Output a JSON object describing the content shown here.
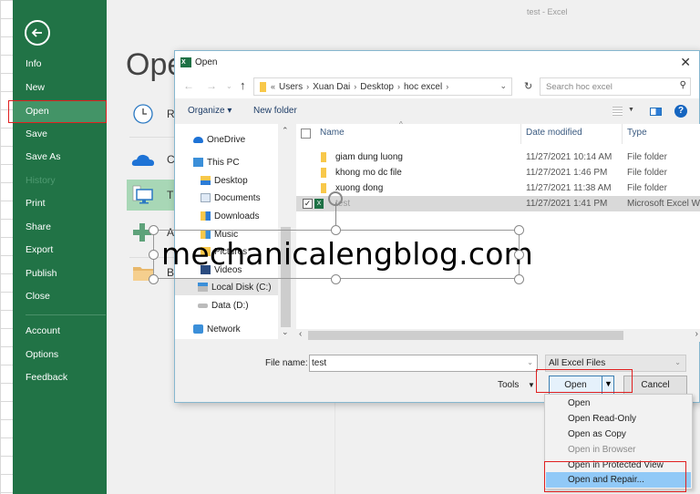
{
  "window": {
    "title": "test - Excel"
  },
  "backstage": {
    "back_icon": "back-arrow-icon",
    "nav": [
      {
        "label": "Info",
        "state": "normal"
      },
      {
        "label": "New",
        "state": "normal"
      },
      {
        "label": "Open",
        "state": "active"
      },
      {
        "label": "Save",
        "state": "normal"
      },
      {
        "label": "Save As",
        "state": "normal"
      },
      {
        "label": "History",
        "state": "disabled"
      },
      {
        "label": "Print",
        "state": "normal"
      },
      {
        "label": "Share",
        "state": "normal"
      },
      {
        "label": "Export",
        "state": "normal"
      },
      {
        "label": "Publish",
        "state": "normal"
      },
      {
        "label": "Close",
        "state": "normal"
      }
    ],
    "nav_bottom": [
      {
        "label": "Account"
      },
      {
        "label": "Options"
      },
      {
        "label": "Feedback"
      }
    ],
    "heading": "Ope",
    "locations": [
      {
        "label": "R",
        "icon": "clock-icon"
      },
      {
        "label": "C",
        "icon": "onedrive-icon"
      },
      {
        "label": "T",
        "icon": "this-pc-icon",
        "selected": true
      },
      {
        "label": "A",
        "icon": "add-place-icon"
      },
      {
        "label": "B",
        "icon": "browse-folder-icon"
      }
    ]
  },
  "dialog": {
    "title": "Open",
    "close_label": "✕",
    "address": {
      "breadcrumbs": [
        "Users",
        "Xuan Dai",
        "Desktop",
        "hoc excel"
      ],
      "prefix": "«"
    },
    "search": {
      "placeholder": "Search hoc excel"
    },
    "toolbar": {
      "organize": "Organize ▾",
      "new_folder": "New folder",
      "help": "?"
    },
    "nav_tree": [
      {
        "label": "OneDrive",
        "icon": "onedrive-icon",
        "level": 0
      },
      {
        "label": "This PC",
        "icon": "pc-icon",
        "level": 0
      },
      {
        "label": "Desktop",
        "icon": "desktop-folder-icon",
        "level": 1
      },
      {
        "label": "Documents",
        "icon": "documents-icon",
        "level": 1
      },
      {
        "label": "Downloads",
        "icon": "downloads-icon",
        "level": 1
      },
      {
        "label": "Music",
        "icon": "music-icon",
        "level": 1
      },
      {
        "label": "Pictures",
        "icon": "pictures-icon",
        "level": 1
      },
      {
        "label": "Videos",
        "icon": "videos-icon",
        "level": 1
      },
      {
        "label": "Local Disk (C:)",
        "icon": "disk-icon",
        "level": 1,
        "selected": true
      },
      {
        "label": "Data (D:)",
        "icon": "disk-icon",
        "level": 1
      },
      {
        "label": "Network",
        "icon": "network-icon",
        "level": 0
      }
    ],
    "columns": {
      "name": "Name",
      "date": "Date modified",
      "type": "Type"
    },
    "files": [
      {
        "name": "giam dung luong",
        "date": "11/27/2021 10:14 AM",
        "type": "File folder",
        "kind": "folder"
      },
      {
        "name": "khong mo dc file",
        "date": "11/27/2021 1:46 PM",
        "type": "File folder",
        "kind": "folder"
      },
      {
        "name": "xuong dong",
        "date": "11/27/2021 11:38 AM",
        "type": "File folder",
        "kind": "folder"
      },
      {
        "name": "test",
        "date": "11/27/2021 1:41 PM",
        "type": "Microsoft Excel Wo",
        "kind": "excel",
        "selected": true,
        "checked": true
      }
    ],
    "file_name_label": "File name:",
    "file_name_value": "test",
    "file_type_filter": "All Excel Files",
    "tools_label": "Tools",
    "open_label": "Open",
    "cancel_label": "Cancel",
    "open_menu": [
      {
        "label": "Open",
        "state": "normal"
      },
      {
        "label": "Open Read-Only",
        "state": "normal"
      },
      {
        "label": "Open as Copy",
        "state": "normal"
      },
      {
        "label": "Open in Browser",
        "state": "disabled"
      },
      {
        "label": "Open in Protected View",
        "state": "normal"
      },
      {
        "label": "Open and Repair...",
        "state": "highlighted"
      }
    ]
  },
  "watermark": {
    "text": "mechanicalengblog.com"
  },
  "colors": {
    "excel_green": "#217346",
    "highlight_red": "#e02020",
    "menu_highlight": "#91c9f7"
  }
}
